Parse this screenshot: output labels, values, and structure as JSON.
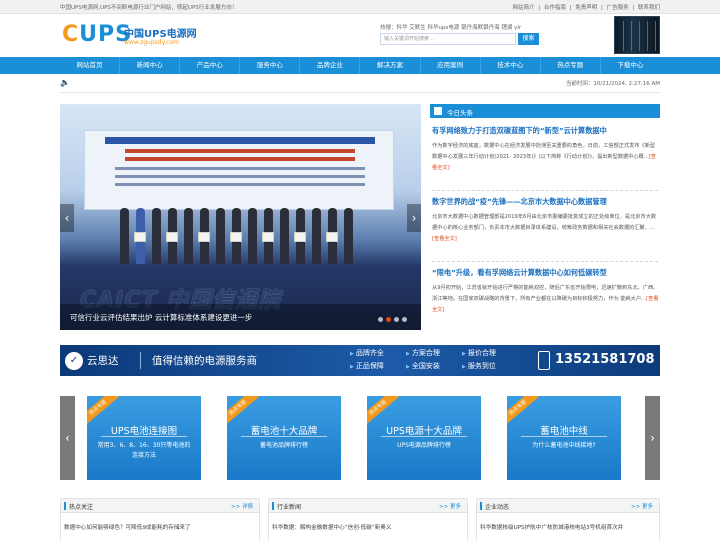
{
  "topbar": {
    "slogan": "中国UPS电源网,UPS不间断电源行业门户网站，撑起UPS行业发展方向！",
    "links": [
      "网站简介",
      "|",
      "合作指南",
      "|",
      "免责声明",
      "|",
      "广告服务",
      "|",
      "联系我们"
    ]
  },
  "header": {
    "logo_mark_1": "C",
    "logo_mark_2": "UPS",
    "logo_cn": "中国UPS电源网",
    "logo_url": "www.zgupsdy.com",
    "hot_label": "热搜：科华  艾默生  科华ups电源  银丹海默银丹海  锂湖 ylr",
    "search_placeholder": "输入关键词开始搜索...",
    "search_button": "搜索"
  },
  "nav": {
    "items": [
      "网站首页",
      "新闻中心",
      "产品中心",
      "服务中心",
      "品牌企业",
      "解决方案",
      "应用案例",
      "技术中心",
      "热点专题",
      "下载中心"
    ]
  },
  "infobar": {
    "speaker_icon": "speaker-icon",
    "time": "当前时间：10/21/2024, 2:27:16 AM"
  },
  "slider": {
    "logo_text": "CAICT 中国信通院",
    "caption": "可信行业云评估结果出炉 云计算标准体系建设更进一步",
    "left_arrow": "‹",
    "right_arrow": "›"
  },
  "news": {
    "header": "今日头条",
    "items": [
      {
        "title": "有孚网络致力于打造双碳蓝图下的“新型”云计算数据中",
        "body": "作为数字经济的底座，数据中心在经济发展中扮演至关重要的角色。日前，工信部正式发布《新型数据中心发展三年行动计划(2021- 2023年)》(以下简称《行动计划》)，提出新型数据中心概...",
        "more": "[查看全文]"
      },
      {
        "title": "数字世界的战“疫”先锋——北京市大数据中心数据管理",
        "body": "北京市大数据中心数据管理部是2019年6月由北京市委编委批复成立的正处级单位，是北京市大数据中心的核心业务部门，负责本市大数据目录体系建设，统筹政务数据和相关社会数据的汇聚、...",
        "more": "[查看全文]"
      },
      {
        "title": "“限电”升级，看有孚网络云计算数据中心如何低碳转型",
        "body": "从9月初开始，江苏省就开始进行严格的能耗双控，随后广东省开始限电，迅速扩散到东北、广西、浙江等地。在国家双碳战略的背景下，所有产业都在以降碳为目标积极努力，作为 能耗大户...",
        "more": "[查看全文]"
      }
    ]
  },
  "banner": {
    "brand": "云思达",
    "slogan": "值得信赖的电源服务商",
    "features": [
      "品牌齐全",
      "方案合理",
      "报价合理",
      "正品保障",
      "全国安装",
      "服务到位"
    ],
    "phone": "13521581708"
  },
  "cards": [
    {
      "ribbon": "热点专题",
      "title": "UPS电池连接图",
      "sub": "常用3、6、8、16、30只等电池的连接方法"
    },
    {
      "ribbon": "热点专题",
      "title": "蓄电池十大品牌",
      "sub": "蓄电池品牌排行榜"
    },
    {
      "ribbon": "热点专题",
      "title": "UPS电源十大品牌",
      "sub": "UPS电源品牌排行榜"
    },
    {
      "ribbon": "热点专题",
      "title": "蓄电池中线",
      "sub": "为什么蓄电池中线接地?"
    }
  ],
  "bottom": [
    {
      "title": "热点关注",
      "more": ">> 详情",
      "item": "数据中心如何能够绿色？可降低9成能耗的存储来了"
    },
    {
      "title": "行业新闻",
      "more": ">> 更多",
      "item": "科华数据：解构金融数据中心“信创·低碳”新奥义"
    },
    {
      "title": "企业动态",
      "more": ">> 更多",
      "item": "科华数据核级UPS护航中广核防城港核电站3号机组首次并"
    }
  ],
  "colors": {
    "primary": "#1a8fd8",
    "accent": "#f39a1c",
    "link": "#1a6fc0",
    "more": "#e04a1c"
  }
}
